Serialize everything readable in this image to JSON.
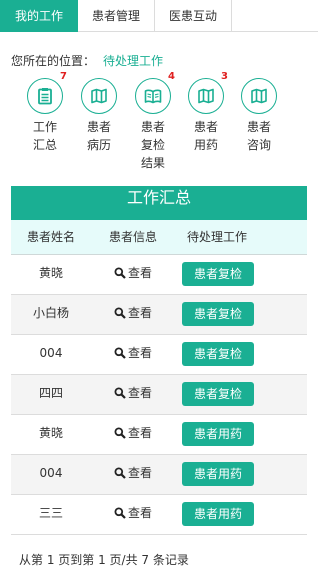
{
  "tabs": [
    {
      "label": "我的工作"
    },
    {
      "label": "患者管理"
    },
    {
      "label": "医患互动"
    }
  ],
  "breadcrumb": {
    "prefix": "您所在的位置：",
    "current": "待处理工作"
  },
  "quick_nav": [
    {
      "label": "工作\n汇总",
      "badge": "7",
      "icon": "clipboard-list-icon"
    },
    {
      "label": "患者\n病历",
      "badge": "",
      "icon": "map-icon"
    },
    {
      "label": "患者\n复检\n结果",
      "badge": "4",
      "icon": "open-book-icon"
    },
    {
      "label": "患者\n用药",
      "badge": "3",
      "icon": "map-icon"
    },
    {
      "label": "患者\n咨询",
      "badge": "",
      "icon": "map-icon"
    }
  ],
  "panel": {
    "title": "工作汇总",
    "columns": [
      "患者姓名",
      "患者信息",
      "待处理工作"
    ],
    "view_label": "查看",
    "rows": [
      {
        "name": "黄晓",
        "action": "患者复检"
      },
      {
        "name": "小白杨",
        "action": "患者复检"
      },
      {
        "name": "004",
        "action": "患者复检"
      },
      {
        "name": "四四",
        "action": "患者复检"
      },
      {
        "name": "黄晓",
        "action": "患者用药"
      },
      {
        "name": "004",
        "action": "患者用药"
      },
      {
        "name": "三三",
        "action": "患者用药"
      }
    ]
  },
  "pagination": {
    "text": "从第 1 页到第 1 页/共 7 条记录"
  },
  "colors": {
    "accent": "#1aaf93",
    "badge": "#e02020",
    "table_header_bg": "#e6fbfa",
    "row_alt_bg": "#f4f4f4"
  }
}
